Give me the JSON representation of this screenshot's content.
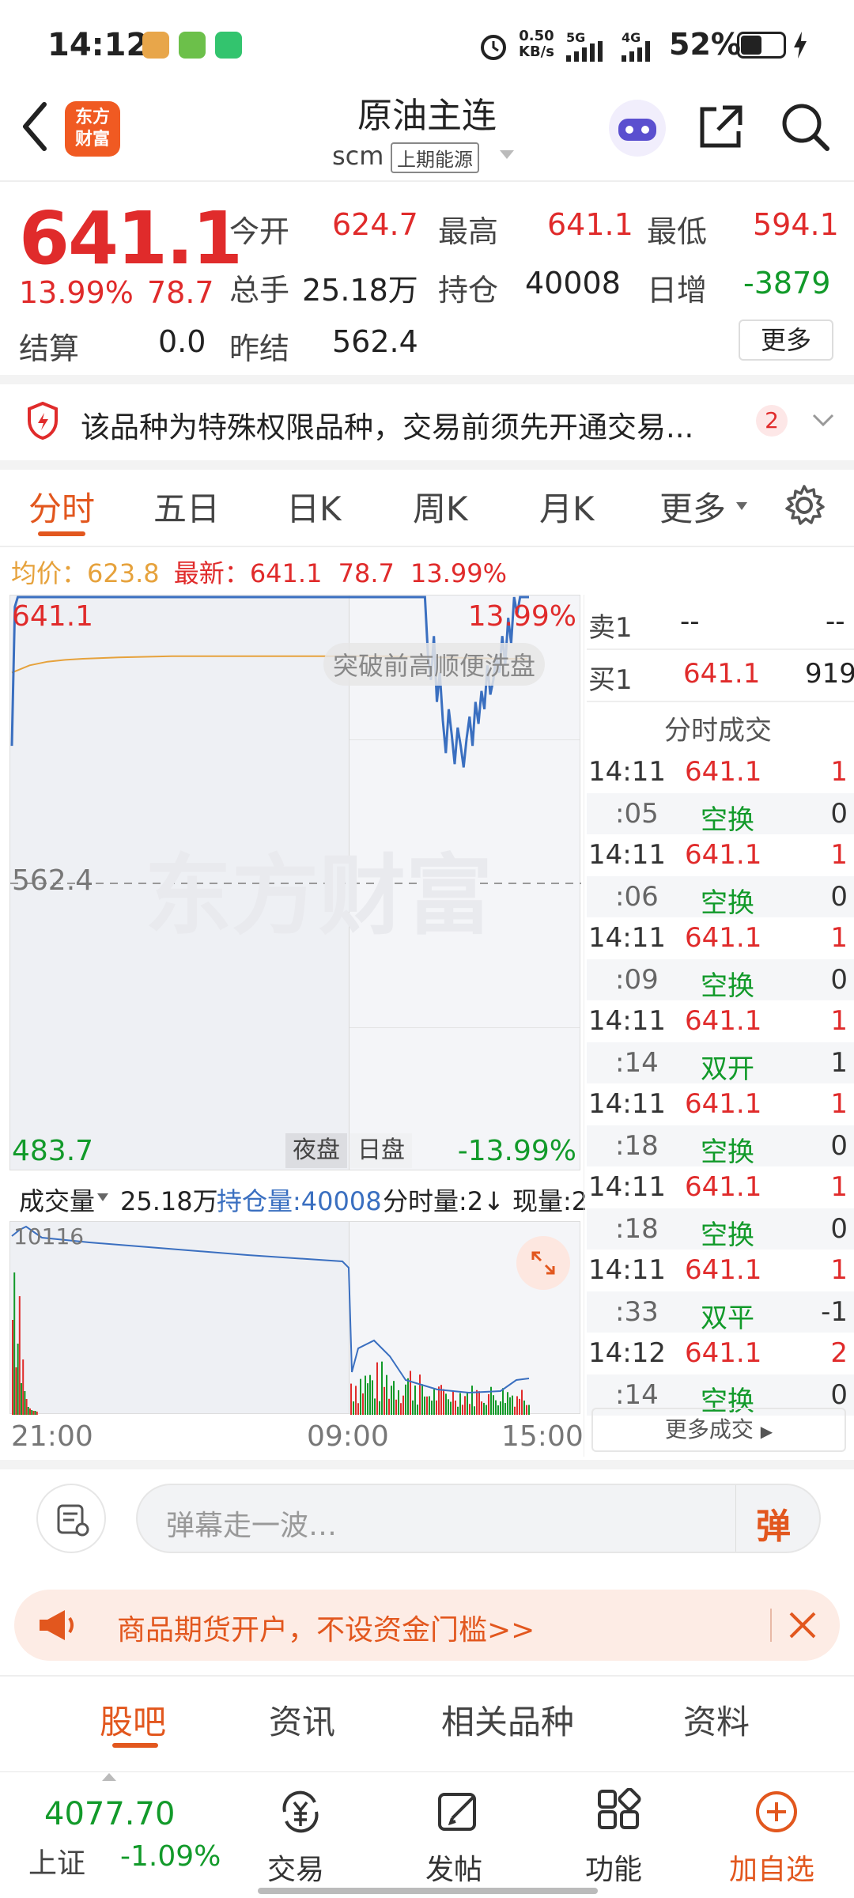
{
  "status": {
    "time": "14:12",
    "net_speed_top": "0.50",
    "net_speed_bottom": "KB/s",
    "sig1": "5G",
    "sig2": "4G",
    "battery": "52%"
  },
  "header": {
    "back_icon": "chevron-left-icon",
    "logo_line1": "东方",
    "logo_line2": "财富",
    "title": "原油主连",
    "code": "scm",
    "exchange": "上期能源",
    "share_icon": "share-icon",
    "search_icon": "search-icon"
  },
  "quote": {
    "price": "641.1",
    "change_pct": "13.99%",
    "change": "78.7",
    "open_label": "今开",
    "open": "624.7",
    "high_label": "最高",
    "high": "641.1",
    "low_label": "最低",
    "low": "594.1",
    "volume_label": "总手",
    "volume": "25.18万",
    "oi_label": "持仓",
    "oi": "40008",
    "oi_change_label": "日增",
    "oi_change": "-3879",
    "settle_label": "结算",
    "settle": "0.0",
    "prev_settle_label": "昨结",
    "prev_settle": "562.4",
    "more_label": "更多"
  },
  "notice": {
    "text": "该品种为特殊权限品种，交易前须先开通交易...",
    "count": "2"
  },
  "tabs": [
    "分时",
    "五日",
    "日K",
    "周K",
    "月K",
    "更多"
  ],
  "chart_info": {
    "avg_label": "均价：",
    "avg": "623.8",
    "latest_label": "最新：",
    "latest": "641.1",
    "change": "78.7",
    "change_pct": "13.99%"
  },
  "chart": {
    "y_top": "641.1",
    "y_top_pct": "13.99%",
    "y_mid": "562.4",
    "y_bottom": "483.7",
    "y_bottom_pct": "-13.99%",
    "overlay_text": "突破前高顺便洗盘",
    "watermark": "东方财富",
    "night_label": "夜盘",
    "day_label": "日盘",
    "vol_selector": "成交量",
    "vol_total": "25.18万",
    "oi_label": "持仓量:40008",
    "tick_label": "分时量:2↓",
    "now_label": "现量:2",
    "vol_max": "10116",
    "x_labels": [
      "21:00",
      "09:00",
      "15:00"
    ]
  },
  "chart_data": {
    "type": "line",
    "title": "",
    "ylim": [
      483.7,
      641.1
    ],
    "series": [
      {
        "name": "",
        "values": [
          600,
          638,
          641.1,
          641.1,
          641.1,
          641.1,
          641.1,
          641.1,
          641.1,
          641.1,
          641.1,
          641.1,
          641.1,
          641.1,
          641.1,
          641.1,
          641.1,
          641.1,
          641.1,
          641.1,
          641.1,
          641.1,
          641.1,
          641.1,
          641.1,
          641.1,
          641.1,
          641.1,
          641.1,
          641.1,
          641.1,
          641.1,
          641.1,
          641.1,
          641.1,
          641.1,
          641.1,
          641.1,
          641.1,
          641.1,
          641.1,
          641.1,
          641.1,
          641.1,
          641.1,
          641.1,
          641.1,
          641.1,
          641.1,
          641.1,
          641.1,
          641.1,
          641.1,
          641.1,
          641.1,
          641.1,
          641.1,
          641.1,
          641.1,
          641.1,
          641.1,
          641.1,
          641.1,
          641.1,
          641.1,
          641.1,
          641.1,
          641.1,
          641.1,
          641.1,
          641.1,
          641.1,
          641.1,
          641.1,
          641.1,
          641.1,
          641.1,
          641.1,
          641.1,
          641.1,
          641.1,
          641.1,
          641.1,
          641.1,
          641.1,
          641.1,
          641.1,
          641.1,
          641.1,
          641.1,
          641.1,
          641.1,
          641.1,
          641.1,
          641.1,
          641.1,
          641.1,
          641.1,
          641.1,
          641.1,
          641.1,
          641.1,
          641.1,
          641.1,
          641.1,
          641.1,
          641.1,
          641.1,
          641.1,
          641.1,
          641.1,
          641.1,
          641.1,
          641.1,
          641.1,
          641.1,
          641.1,
          641.1,
          641.1,
          641.1,
          641.1,
          641.1,
          641.1,
          641.1,
          641.1,
          641.1,
          641.1,
          641.1,
          641.1,
          641.1,
          641.1,
          641.1,
          641.1,
          641.1,
          641.1,
          641.1,
          641.1,
          641.1,
          641.1,
          641.1,
          625,
          618,
          630,
          612,
          620,
          607,
          598,
          610,
          603,
          595,
          605,
          600,
          594.1,
          602,
          608,
          600,
          612,
          606,
          615,
          610,
          622,
          614,
          618,
          625,
          620,
          630,
          622,
          635,
          628,
          641.1,
          636,
          641.1,
          641.1,
          641.1,
          641.1
        ]
      },
      {
        "name": "",
        "values": [
          620,
          622,
          623,
          623.5,
          623.8,
          624,
          624.2,
          624.3,
          624.4,
          624.5,
          624.5,
          624.5,
          624.5,
          624.5,
          624.5,
          624.5,
          624.5,
          624.5,
          624.5,
          624.5,
          624.5,
          624.5,
          624.4,
          624.3,
          624.2,
          624.1,
          624,
          623.9,
          623.8,
          623.8
        ]
      }
    ]
  },
  "order_book": {
    "ask_label": "卖1",
    "ask_price": "--",
    "ask_vol": "--",
    "bid_label": "买1",
    "bid_price": "641.1",
    "bid_vol": "919",
    "trades_title": "分时成交",
    "more_trades": "更多成交"
  },
  "trades": [
    {
      "time": "14:11",
      "price": "641.1",
      "vol": "1",
      "sec": ":05",
      "type": "空换",
      "dvol": "0"
    },
    {
      "time": "14:11",
      "price": "641.1",
      "vol": "1",
      "sec": ":06",
      "type": "空换",
      "dvol": "0"
    },
    {
      "time": "14:11",
      "price": "641.1",
      "vol": "1",
      "sec": ":09",
      "type": "空换",
      "dvol": "0"
    },
    {
      "time": "14:11",
      "price": "641.1",
      "vol": "1",
      "sec": ":14",
      "type": "双开",
      "dvol": "1"
    },
    {
      "time": "14:11",
      "price": "641.1",
      "vol": "1",
      "sec": ":18",
      "type": "空换",
      "dvol": "0"
    },
    {
      "time": "14:11",
      "price": "641.1",
      "vol": "1",
      "sec": ":18",
      "type": "空换",
      "dvol": "0"
    },
    {
      "time": "14:11",
      "price": "641.1",
      "vol": "1",
      "sec": ":33",
      "type": "双平",
      "dvol": "-1"
    },
    {
      "time": "14:12",
      "price": "641.1",
      "vol": "2",
      "sec": ":14",
      "type": "空换",
      "dvol": "0"
    }
  ],
  "comment": {
    "placeholder": "弹幕走一波…",
    "danmu_btn": "弹"
  },
  "banner": {
    "text": "商品期货开户，不设资金门槛>>"
  },
  "section_tabs": [
    "股吧",
    "资讯",
    "相关品种",
    "资料"
  ],
  "bottom_nav": {
    "index_value": "4077.70",
    "index_name": "上证",
    "index_change": "-1.09%",
    "trade": "交易",
    "post": "发帖",
    "functions": "功能",
    "add_watch": "加自选"
  },
  "colors": {
    "up": "#e02b2b",
    "down": "#129a2a",
    "accent": "#e2571e",
    "avg_line": "#e6a23c",
    "price_line": "#3a6fc0"
  }
}
